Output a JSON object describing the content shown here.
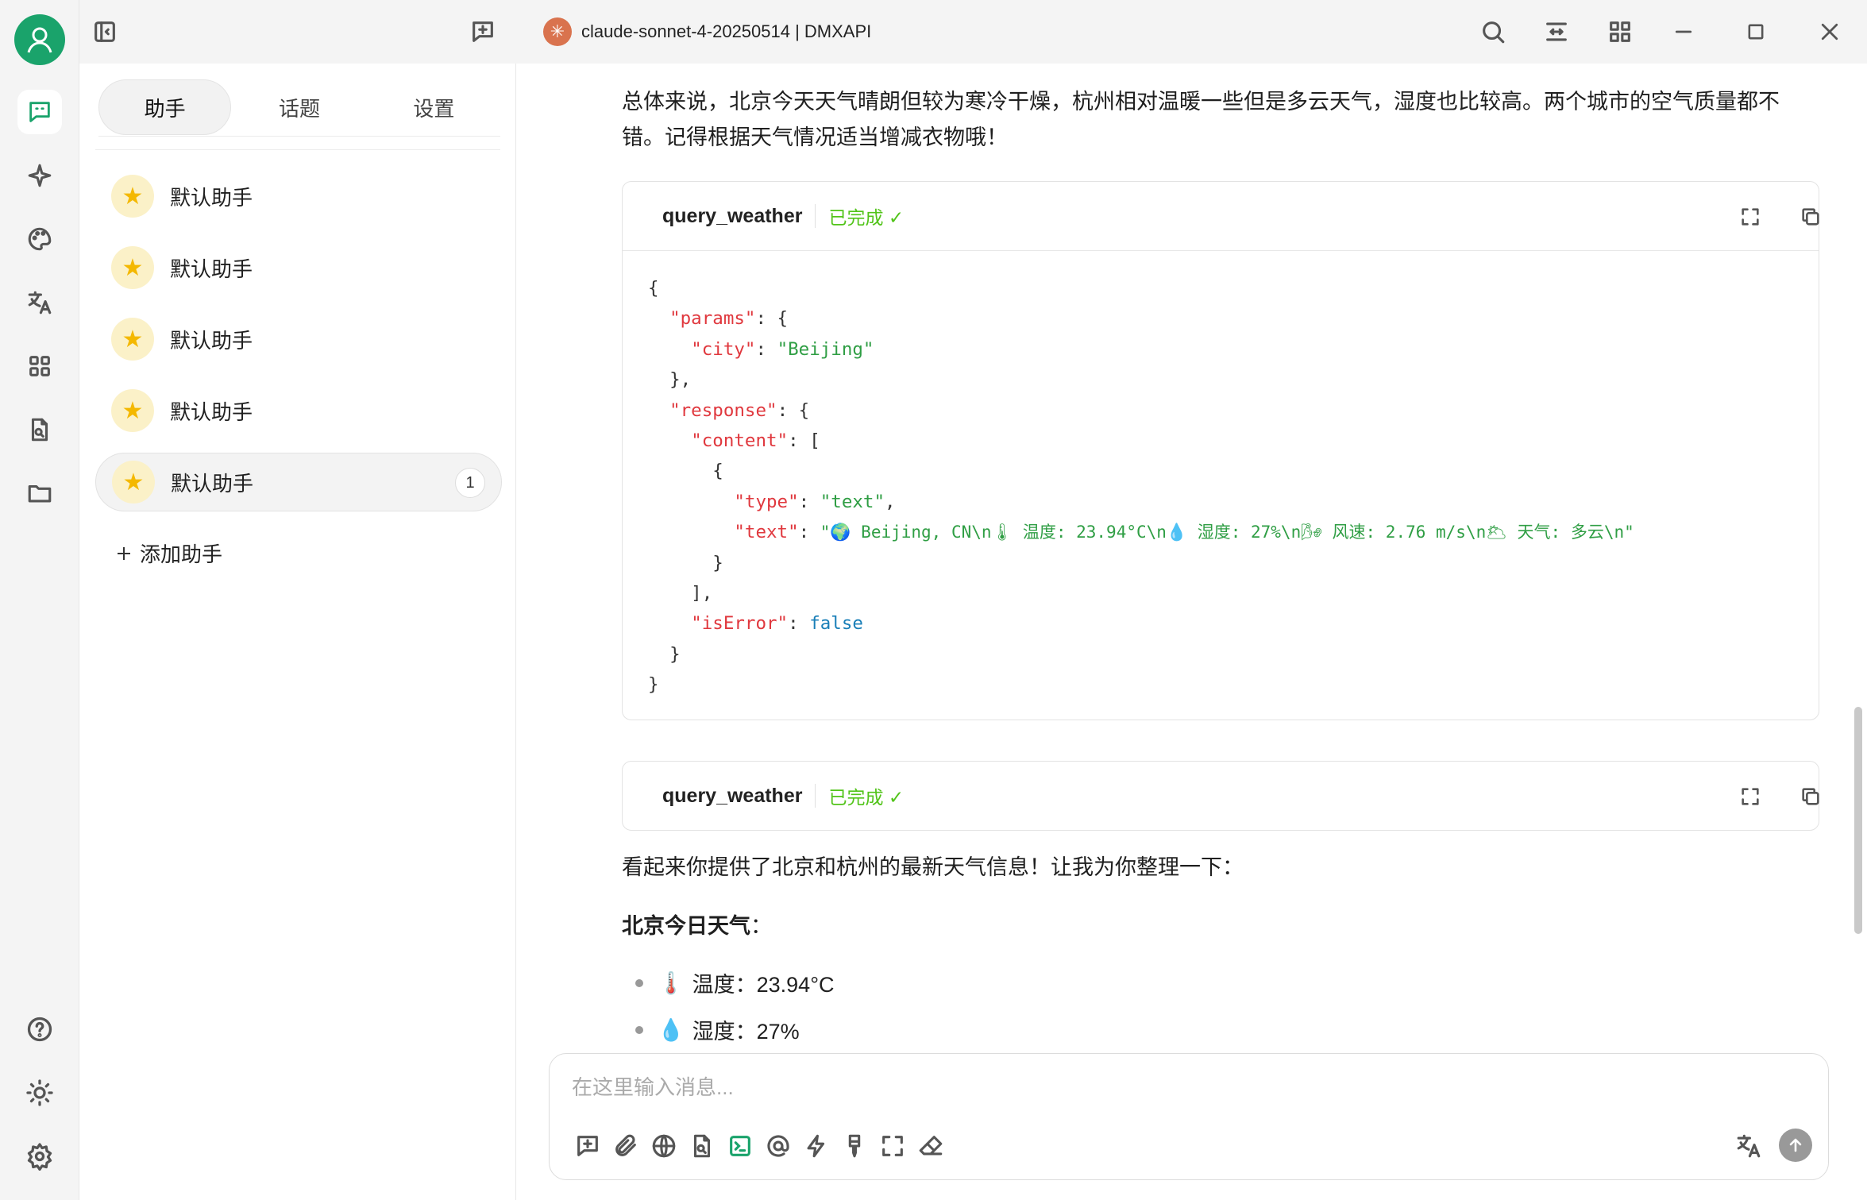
{
  "window": {
    "title": "claude-sonnet-4-20250514 | DMXAPI"
  },
  "sidebar": {
    "tabs": [
      {
        "label": "助手"
      },
      {
        "label": "话题"
      },
      {
        "label": "设置"
      }
    ],
    "assistants": [
      {
        "label": "默认助手"
      },
      {
        "label": "默认助手"
      },
      {
        "label": "默认助手"
      },
      {
        "label": "默认助手"
      },
      {
        "label": "默认助手",
        "badge": "1"
      }
    ],
    "add_label": "添加助手"
  },
  "chat": {
    "summary": "总体来说，北京今天天气晴朗但较为寒冷干燥，杭州相对温暖一些但是多云天气，湿度也比较高。两个城市的空气质量都不错。记得根据天气情况适当增减衣物哦！",
    "tool_calls": [
      {
        "name": "query_weather",
        "status": "已完成 ✓"
      },
      {
        "name": "query_weather",
        "status": "已完成 ✓"
      }
    ],
    "code": {
      "city_value": "\"Beijing\"",
      "type_value": "\"text\"",
      "text_value": "\"🌍 Beijing, CN\\n🌡 温度: 23.94°C\\n💧 湿度: 27%\\n🌬 风速: 2.76 m/s\\n🌥 天气: 多云\\n\"",
      "is_error": "false"
    },
    "reply_intro": "看起来你提供了北京和杭州的最新天气信息！让我为你整理一下：",
    "beijing_heading": "北京今日天气",
    "beijing_colon": "：",
    "bullets": [
      {
        "emoji": "🌡️",
        "text": "温度：23.94°C"
      },
      {
        "emoji": "💧",
        "text": "湿度：27%"
      }
    ]
  },
  "input": {
    "placeholder": "在这里输入消息..."
  },
  "colors": {
    "accent": "#1aa36b",
    "success": "#52c41a",
    "assistant_icon_bg": "#fbf1c8",
    "title_logo": "#d9734e"
  }
}
